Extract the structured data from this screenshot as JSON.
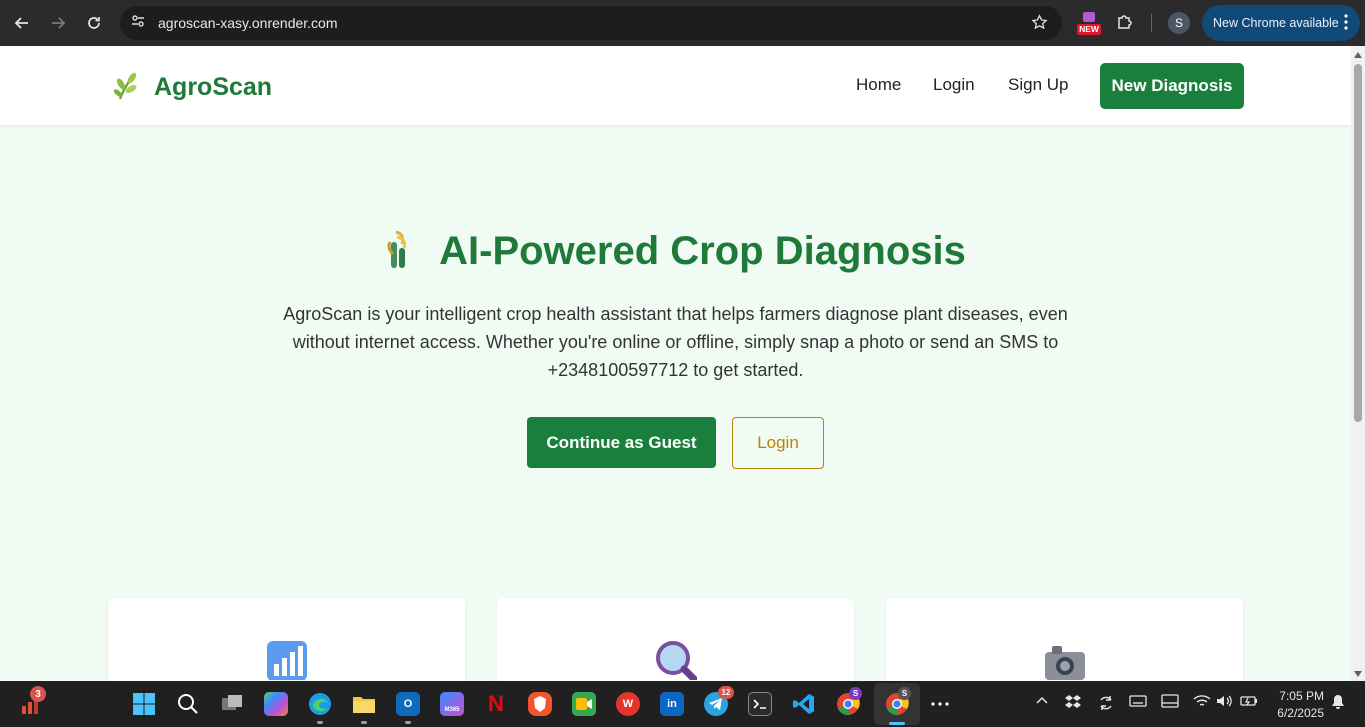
{
  "browser": {
    "url": "agroscan-xasy.onrender.com",
    "profile_initial": "S",
    "new_badge": "NEW",
    "update_label": "New Chrome available"
  },
  "header": {
    "brand": "AgroScan",
    "nav": [
      "Home",
      "Login",
      "Sign Up"
    ],
    "cta": "New Diagnosis"
  },
  "hero": {
    "title": "AI-Powered Crop Diagnosis",
    "description": "AgroScan is your intelligent crop health assistant that helps farmers diagnose plant diseases, even without internet access. Whether you're online or offline, simply snap a photo or send an SMS to +2348100597712 to get started.",
    "primary_button": "Continue as Guest",
    "secondary_button": "Login"
  },
  "cards": [
    {
      "icon": "bar-chart-icon"
    },
    {
      "icon": "magnifier-icon"
    },
    {
      "icon": "camera-icon"
    }
  ],
  "taskbar": {
    "notification_count": "3",
    "telegram_badge": "12",
    "profile_badge": "S",
    "m365_label": "M365",
    "time": "7:05 PM",
    "date": "6/2/2025"
  },
  "colors": {
    "brand_green": "#1f7a3a",
    "button_green": "#1a7f3c",
    "login_border": "#b8860b",
    "page_bg": "#f0fbf4"
  }
}
